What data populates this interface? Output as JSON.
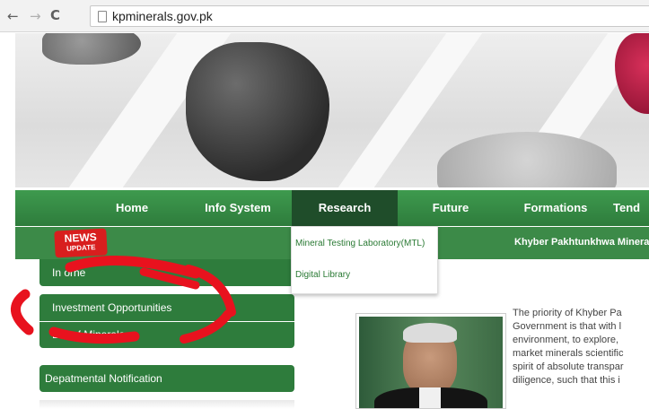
{
  "browser": {
    "back": "←",
    "forward": "→",
    "reload": "C",
    "url": "kpminerals.gov.pk"
  },
  "menu": {
    "items": [
      "Home",
      "Info System",
      "Research",
      "Future",
      "Formations",
      "Tend"
    ],
    "active": "Research"
  },
  "news": {
    "badge_top": "NEWS",
    "badge_bottom": "UPDATE",
    "ticker": "Khyber Pakhtunkhwa Mineral"
  },
  "dropdown": {
    "items": [
      "Mineral Testing Laboratory(MTL)",
      "Digital Library"
    ]
  },
  "side_menu": {
    "items": [
      "In      orne",
      "Investment Opportunities",
      "List of Minerals",
      "Depatmental Notification"
    ]
  },
  "intro": {
    "lines": [
      "The priority of Khyber Pa",
      "Government is that with l",
      "environment, to explore,",
      "market minerals scientific",
      "spirit of absolute transpar",
      "diligence, such that this i"
    ]
  },
  "colors": {
    "menu_green": "#2e7c3c",
    "menu_active": "#1f4d2a",
    "annotation_red": "#e8121e"
  }
}
